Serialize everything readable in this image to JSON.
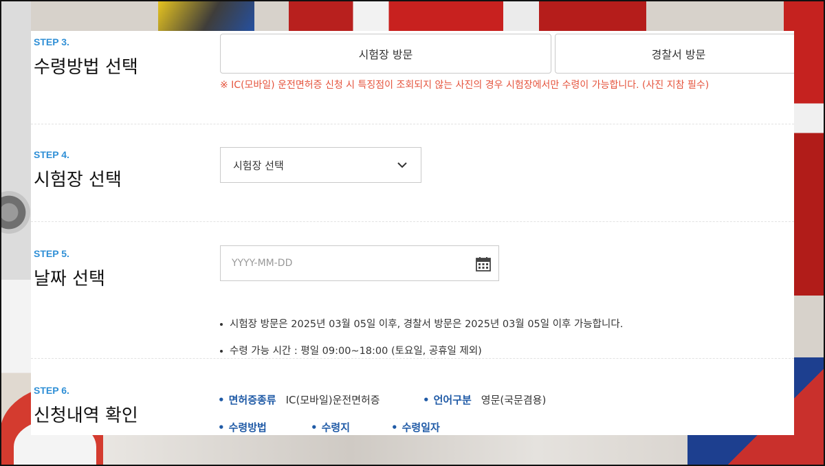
{
  "step3": {
    "step": "STEP 3.",
    "title": "수령방법 선택",
    "options": [
      "시험장 방문",
      "경찰서 방문"
    ],
    "notice": "※ IC(모바일) 운전면허증 신청 시 특징점이 조회되지 않는 사진의 경우 시험장에서만 수령이 가능합니다. (사진 지참 필수)"
  },
  "step4": {
    "step": "STEP 4.",
    "title": "시험장 선택",
    "select_value": "시험장 선택",
    "select_icon": "chevron-down-icon"
  },
  "step5": {
    "step": "STEP 5.",
    "title": "날짜 선택",
    "date_placeholder": "YYYY-MM-DD",
    "date_icon": "calendar-icon",
    "notes": [
      "시험장 방문은 2025년 03월 05일 이후, 경찰서 방문은 2025년 03월 05일 이후 가능합니다.",
      "수령 가능 시간 : 평일 09:00~18:00 (토요일, 공휴일 제외)"
    ]
  },
  "step6": {
    "step": "STEP 6.",
    "title": "신청내역 확인",
    "license_type_label": "면허증종류",
    "license_type_value": "IC(모바일)운전면허증",
    "language_label": "언어구분",
    "language_value": "영문(국문겸용)",
    "method_label": "수령방법",
    "place_label": "수령지",
    "date_label": "수령일자"
  },
  "colors": {
    "step_label": "#2f8fd6",
    "notice": "#e5533c",
    "key_label": "#1f5aa6"
  }
}
